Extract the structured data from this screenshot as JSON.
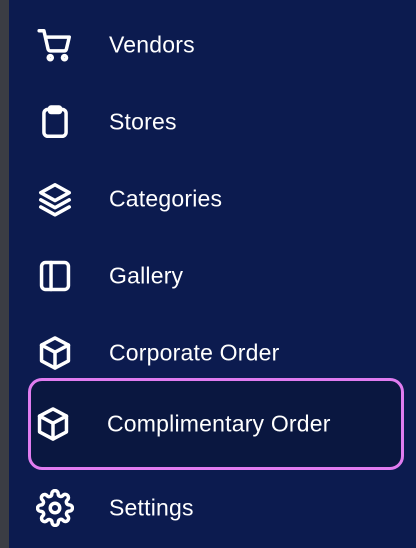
{
  "sidebar": {
    "items": [
      {
        "label": "Vendors",
        "icon": "shopping-cart-icon",
        "active": false
      },
      {
        "label": "Stores",
        "icon": "clipboard-icon",
        "active": false
      },
      {
        "label": "Categories",
        "icon": "layers-icon",
        "active": false
      },
      {
        "label": "Gallery",
        "icon": "sidebar-panel-icon",
        "active": false
      },
      {
        "label": "Corporate Order",
        "icon": "package-box-icon",
        "active": false
      },
      {
        "label": "Complimentary Order",
        "icon": "package-box-icon",
        "active": true
      },
      {
        "label": "Settings",
        "icon": "gear-icon",
        "active": false
      }
    ]
  },
  "colors": {
    "background": "#0c1b4f",
    "text": "#ffffff",
    "active_border": "#e07cf0",
    "active_background": "#0a1740"
  }
}
